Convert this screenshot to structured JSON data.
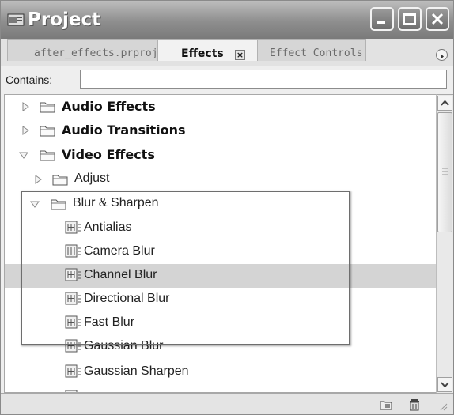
{
  "window": {
    "title": "Project"
  },
  "tabs": [
    {
      "label": "after_effects.prproj",
      "active": false
    },
    {
      "label": "Effects",
      "active": true
    },
    {
      "label": "Effect Controls",
      "active": false
    }
  ],
  "search": {
    "label": "Contains:",
    "value": ""
  },
  "tree": {
    "rows": [
      {
        "label": "Audio Effects",
        "kind": "folder",
        "expanded": false,
        "bold": true
      },
      {
        "label": "Audio Transitions",
        "kind": "folder",
        "expanded": false,
        "bold": true
      },
      {
        "label": "Video Effects",
        "kind": "folder",
        "expanded": true,
        "bold": true
      },
      {
        "label": "Adjust",
        "kind": "folder",
        "expanded": false,
        "bold": false
      },
      {
        "label": "Blur & Sharpen",
        "kind": "folder",
        "expanded": true,
        "bold": false
      },
      {
        "label": "Antialias",
        "kind": "effect"
      },
      {
        "label": "Camera Blur",
        "kind": "effect"
      },
      {
        "label": "Channel Blur",
        "kind": "effect",
        "selected": true
      },
      {
        "label": "Directional Blur",
        "kind": "effect"
      },
      {
        "label": "Fast Blur",
        "kind": "effect"
      },
      {
        "label": "Gaussian Blur",
        "kind": "effect"
      },
      {
        "label": "Gaussian Sharpen",
        "kind": "effect"
      }
    ]
  },
  "icons": {
    "app": "project-window-icon",
    "folder": "folder-icon",
    "effect": "video-effect-icon",
    "new_bin": "new-bin-icon",
    "delete": "trash-icon"
  },
  "colors": {
    "selected_row": "#d4d4d4",
    "titlebar": "#8e8e8e"
  }
}
